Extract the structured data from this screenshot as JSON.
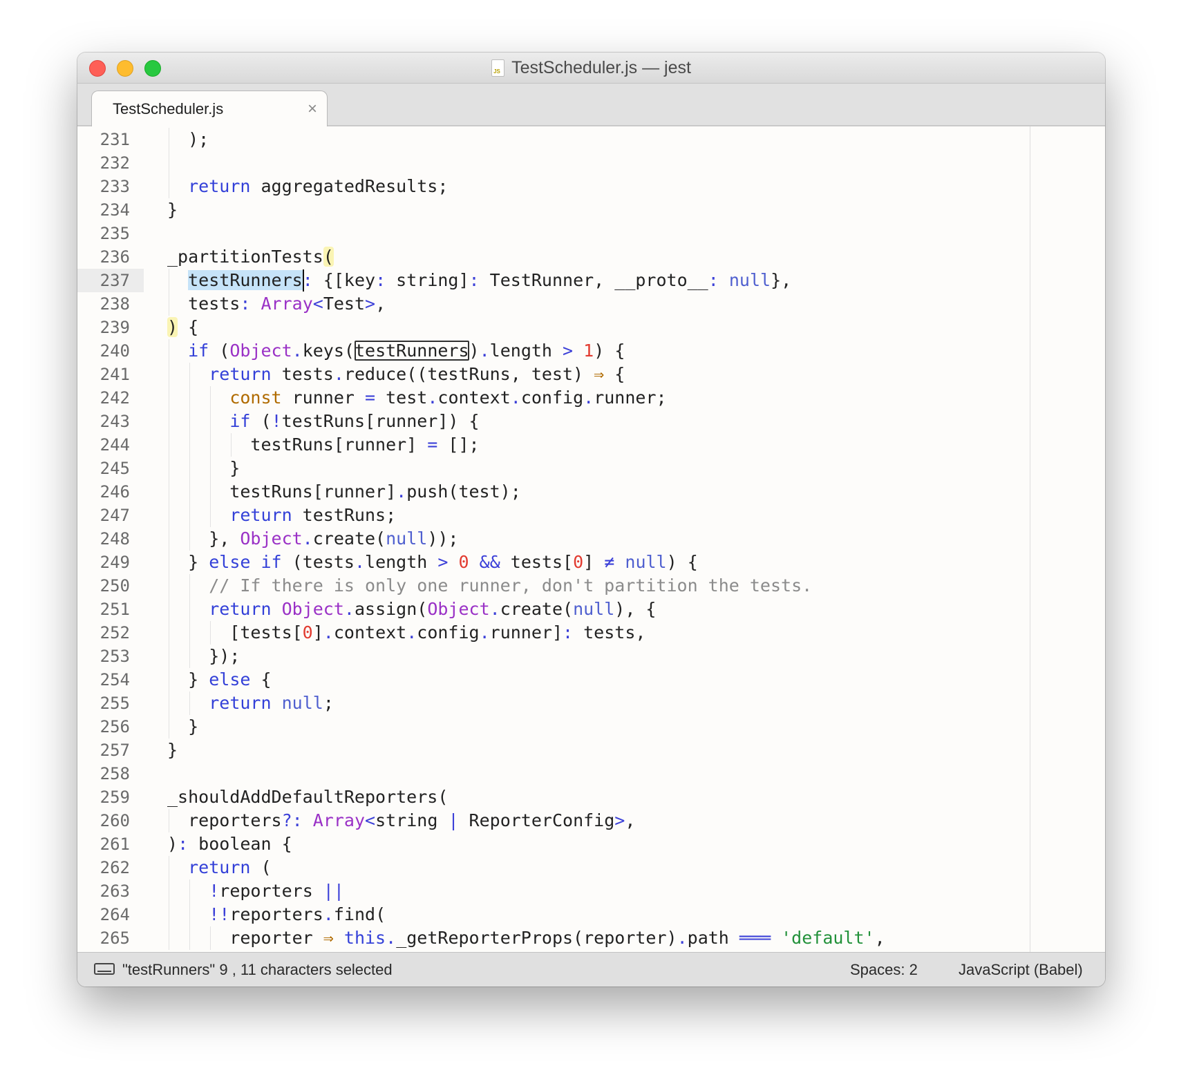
{
  "window": {
    "title": "TestScheduler.js — jest",
    "file_icon_label": "JS"
  },
  "tab": {
    "label": "TestScheduler.js",
    "close_glyph": "×"
  },
  "editor": {
    "current_line": 237,
    "lines": [
      {
        "n": "231",
        "code": "  );"
      },
      {
        "n": "232",
        "code": ""
      },
      {
        "n": "233",
        "code": "  return aggregatedResults;"
      },
      {
        "n": "234",
        "code": "}"
      },
      {
        "n": "235",
        "code": ""
      },
      {
        "n": "236",
        "code": "_partitionTests("
      },
      {
        "n": "237",
        "code": "  testRunners: {[key: string]: TestRunner, __proto__: null},"
      },
      {
        "n": "238",
        "code": "  tests: Array<Test>,"
      },
      {
        "n": "239",
        "code": ") {"
      },
      {
        "n": "240",
        "code": "  if (Object.keys(testRunners).length > 1) {"
      },
      {
        "n": "241",
        "code": "    return tests.reduce((testRuns, test) ⇒ {"
      },
      {
        "n": "242",
        "code": "      const runner = test.context.config.runner;"
      },
      {
        "n": "243",
        "code": "      if (!testRuns[runner]) {"
      },
      {
        "n": "244",
        "code": "        testRuns[runner] = [];"
      },
      {
        "n": "245",
        "code": "      }"
      },
      {
        "n": "246",
        "code": "      testRuns[runner].push(test);"
      },
      {
        "n": "247",
        "code": "      return testRuns;"
      },
      {
        "n": "248",
        "code": "    }, Object.create(null));"
      },
      {
        "n": "249",
        "code": "  } else if (tests.length > 0 && tests[0] ≠ null) {"
      },
      {
        "n": "250",
        "code": "    // If there is only one runner, don't partition the tests."
      },
      {
        "n": "251",
        "code": "    return Object.assign(Object.create(null), {"
      },
      {
        "n": "252",
        "code": "      [tests[0].context.config.runner]: tests,"
      },
      {
        "n": "253",
        "code": "    });"
      },
      {
        "n": "254",
        "code": "  } else {"
      },
      {
        "n": "255",
        "code": "    return null;"
      },
      {
        "n": "256",
        "code": "  }"
      },
      {
        "n": "257",
        "code": "}"
      },
      {
        "n": "258",
        "code": ""
      },
      {
        "n": "259",
        "code": "_shouldAddDefaultReporters("
      },
      {
        "n": "260",
        "code": "  reporters?: Array<string | ReporterConfig>,"
      },
      {
        "n": "261",
        "code": "): boolean {"
      },
      {
        "n": "262",
        "code": "  return ("
      },
      {
        "n": "263",
        "code": "    !reporters ||"
      },
      {
        "n": "264",
        "code": "    !!reporters.find("
      },
      {
        "n": "265",
        "code": "      reporter ⇒ this._getReporterProps(reporter).path ═══ 'default',"
      }
    ]
  },
  "statusbar": {
    "selection_text": "\"testRunners\" 9 , 11 characters selected",
    "indentation": "Spaces: 2",
    "syntax": "JavaScript (Babel)"
  },
  "colors": {
    "keyword": "#3340d8",
    "declaration": "#b06b00",
    "type": "#9a31c6",
    "number": "#e23b30",
    "literal": "#4f5fcf",
    "comment": "#8b8b8b",
    "string": "#22913a",
    "selection": "#c6e3f8",
    "bracket_highlight": "#faf4b4"
  }
}
